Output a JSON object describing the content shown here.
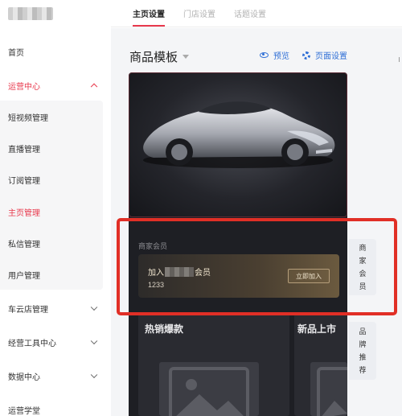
{
  "sidebar": {
    "items": [
      {
        "label": "首页"
      },
      {
        "label": "运营中心"
      },
      {
        "label": "短视频管理"
      },
      {
        "label": "直播管理"
      },
      {
        "label": "订阅管理"
      },
      {
        "label": "主页管理"
      },
      {
        "label": "私信管理"
      },
      {
        "label": "用户管理"
      },
      {
        "label": "车云店管理"
      },
      {
        "label": "经营工具中心"
      },
      {
        "label": "数据中心"
      },
      {
        "label": "运营学堂"
      }
    ],
    "active_item": "主页管理",
    "expanded_group": "运营中心"
  },
  "tabs": [
    {
      "label": "主页设置"
    },
    {
      "label": "门店设置"
    },
    {
      "label": "话题设置"
    }
  ],
  "main": {
    "title": "商品模板",
    "preview_label": "预览",
    "page_settings_label": "页面设置"
  },
  "preview": {
    "member_section_label": "商家会员",
    "member_card_prefix": "加入",
    "member_card_suffix": "会员",
    "member_card_number": "1233",
    "join_button": "立即加入",
    "product_sections": [
      {
        "title": "热销爆款"
      },
      {
        "title": "新品上市"
      }
    ]
  },
  "side_tabs": [
    {
      "label": "商家会员",
      "chars": [
        "商",
        "家",
        "会",
        "员"
      ]
    },
    {
      "label": "品牌推荐",
      "chars": [
        "品",
        "牌",
        "推",
        "荐"
      ]
    }
  ],
  "colors": {
    "accent": "#e8394d",
    "link": "#2f6fd6",
    "highlight_border": "#e12f26",
    "phone_bg": "#1e1f24"
  }
}
